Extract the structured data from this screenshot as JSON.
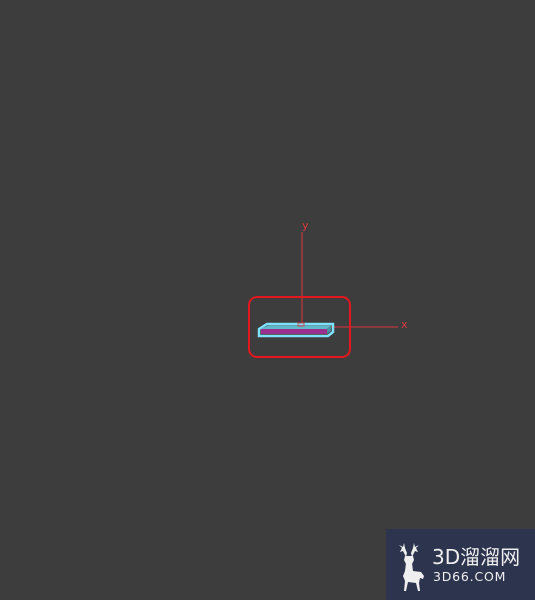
{
  "viewport": {
    "background": "#3d3d3d"
  },
  "gizmo": {
    "axis_color": "#d9393f",
    "x_label": "x",
    "y_label": "y"
  },
  "object": {
    "top_face_color": "#5fb7c9",
    "front_face_color": "#9a2f8e",
    "selection_outline_color": "#7fe1ff"
  },
  "highlight": {
    "color": "#e3171d"
  },
  "watermark": {
    "name": "3D溜溜网",
    "url": "3D66.COM",
    "background": "#2c3550",
    "logo_icon": "deer-icon"
  }
}
